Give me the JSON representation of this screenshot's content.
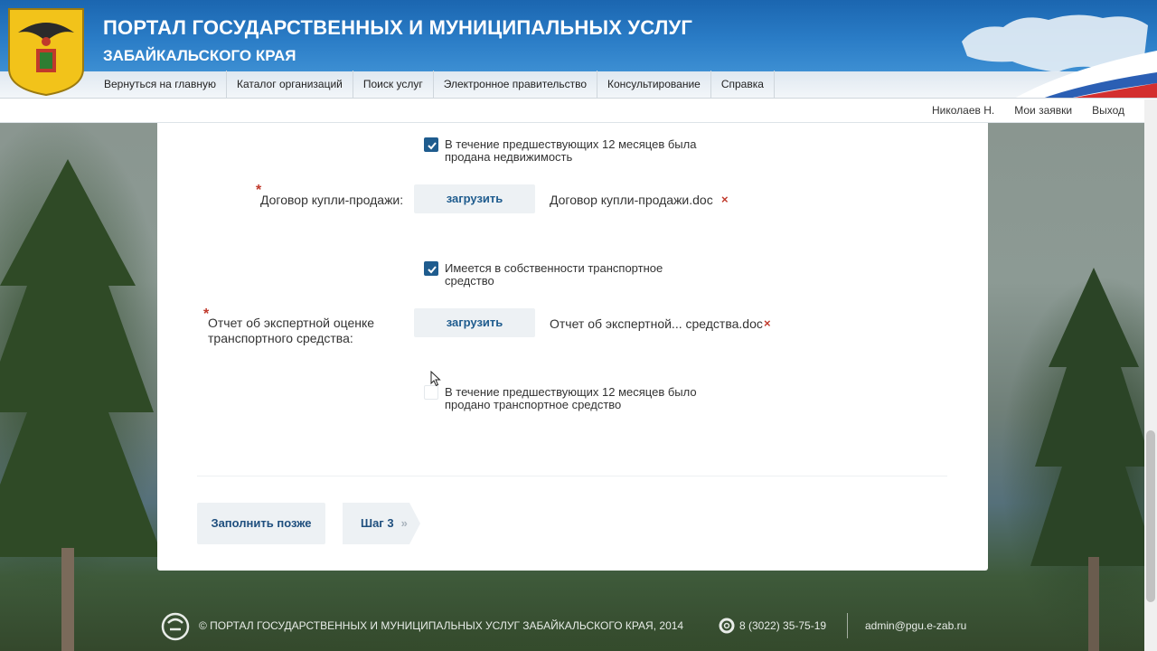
{
  "header": {
    "title_line1": "ПОРТАЛ ГОСУДАРСТВЕННЫХ И МУНИЦИПАЛЬНЫХ УСЛУГ",
    "title_line2": "ЗАБАЙКАЛЬСКОГО КРАЯ",
    "nav": [
      {
        "label": "Вернуться на главную"
      },
      {
        "label": "Каталог организаций"
      },
      {
        "label": "Поиск услуг"
      },
      {
        "label": "Электронное правительство"
      },
      {
        "label": "Консультирование"
      },
      {
        "label": "Справка"
      }
    ],
    "user_links": {
      "user": "Николаев Н.",
      "my_requests": "Мои заявки",
      "logout": "Выход"
    }
  },
  "form": {
    "checkbox_property_sold": {
      "checked": true,
      "label": "В течение предшествующих 12 месяцев была продана недвижимость"
    },
    "sale_contract": {
      "label": "Договор купли-продажи:",
      "required": true,
      "upload_label": "загрузить",
      "file_name": "Договор купли-продажи.doc",
      "remove_icon": "×"
    },
    "checkbox_vehicle_owned": {
      "checked": true,
      "label": "Имеется в собственности транспортное средство"
    },
    "vehicle_appraisal": {
      "label": "Отчет об экспертной оценке транспортного средства:",
      "required": true,
      "upload_label": "загрузить",
      "file_name": "Отчет об экспертной... средства.doc",
      "remove_icon": "×"
    },
    "checkbox_vehicle_sold": {
      "checked": false,
      "label": "В течение предшествующих 12 месяцев было продано транспортное средство"
    },
    "required_marker": "*"
  },
  "actions": {
    "fill_later": "Заполнить позже",
    "next_step": "Шаг 3",
    "next_chevron": "»"
  },
  "footer": {
    "copyright": "© ПОРТАЛ ГОСУДАРСТВЕННЫХ И МУНИЦИПАЛЬНЫХ УСЛУГ ЗАБАЙКАЛЬСКОГО КРАЯ, 2014",
    "phone": "8 (3022) 35-75-19",
    "email": "admin@pgu.e-zab.ru"
  },
  "colors": {
    "header_blue": "#2a7cc6",
    "accent_blue": "#1f5c8e",
    "required_red": "#c0392b",
    "button_bg": "#edf1f4"
  }
}
